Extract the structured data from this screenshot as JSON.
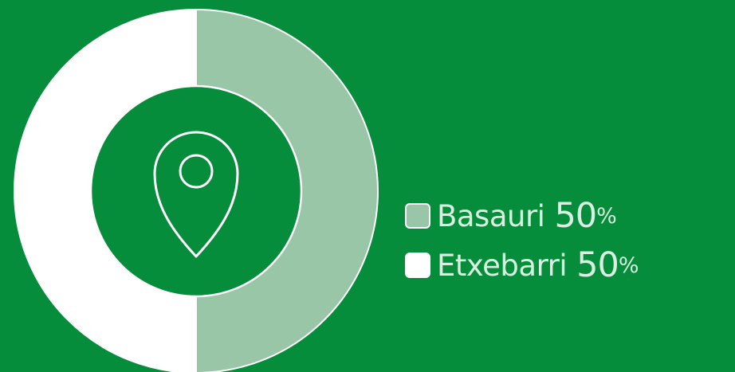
{
  "colors": {
    "background": "#068D3C",
    "basauri": "#99C6A6",
    "etxebarri": "#FFFFFF",
    "inner": "#068D3C",
    "icon_stroke": "#FFFFFF",
    "legend_text": "#D9F0E0",
    "swatch_border": "#FFFFFF"
  },
  "chart_data": {
    "type": "pie",
    "style": "donut",
    "center_icon": "location-pin-icon",
    "series": [
      {
        "name": "Basauri",
        "value": 50,
        "value_label": "50",
        "unit": "%",
        "color": "#99C6A6"
      },
      {
        "name": "Etxebarri",
        "value": 50,
        "value_label": "50",
        "unit": "%",
        "color": "#FFFFFF"
      }
    ]
  }
}
